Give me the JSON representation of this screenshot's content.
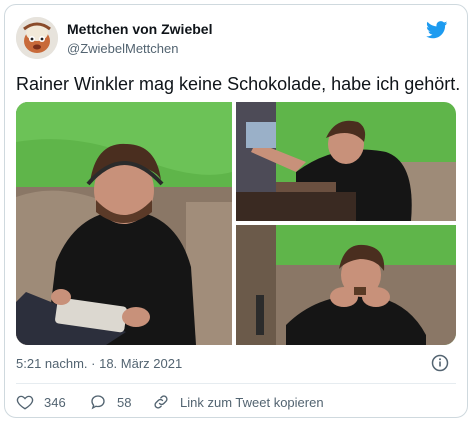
{
  "author": {
    "display_name": "Mettchen von Zwiebel",
    "handle": "@ZwiebelMettchen"
  },
  "tweet": {
    "text": "Rainer Winkler mag keine Schokolade, habe ich gehört.",
    "timestamp": "5:21 nachm. · 18. März 2021"
  },
  "actions": {
    "likes": "346",
    "replies": "58",
    "copy_label": "Link zum Tweet kopieren"
  },
  "icons": {
    "brand": "twitter-bird-icon",
    "info": "info-icon",
    "like": "heart-icon",
    "reply": "reply-bubble-icon",
    "copy": "link-icon"
  },
  "colors": {
    "brand": "#1d9bf0",
    "secondary_text": "#536471",
    "green_screen": "#5fb54a"
  }
}
